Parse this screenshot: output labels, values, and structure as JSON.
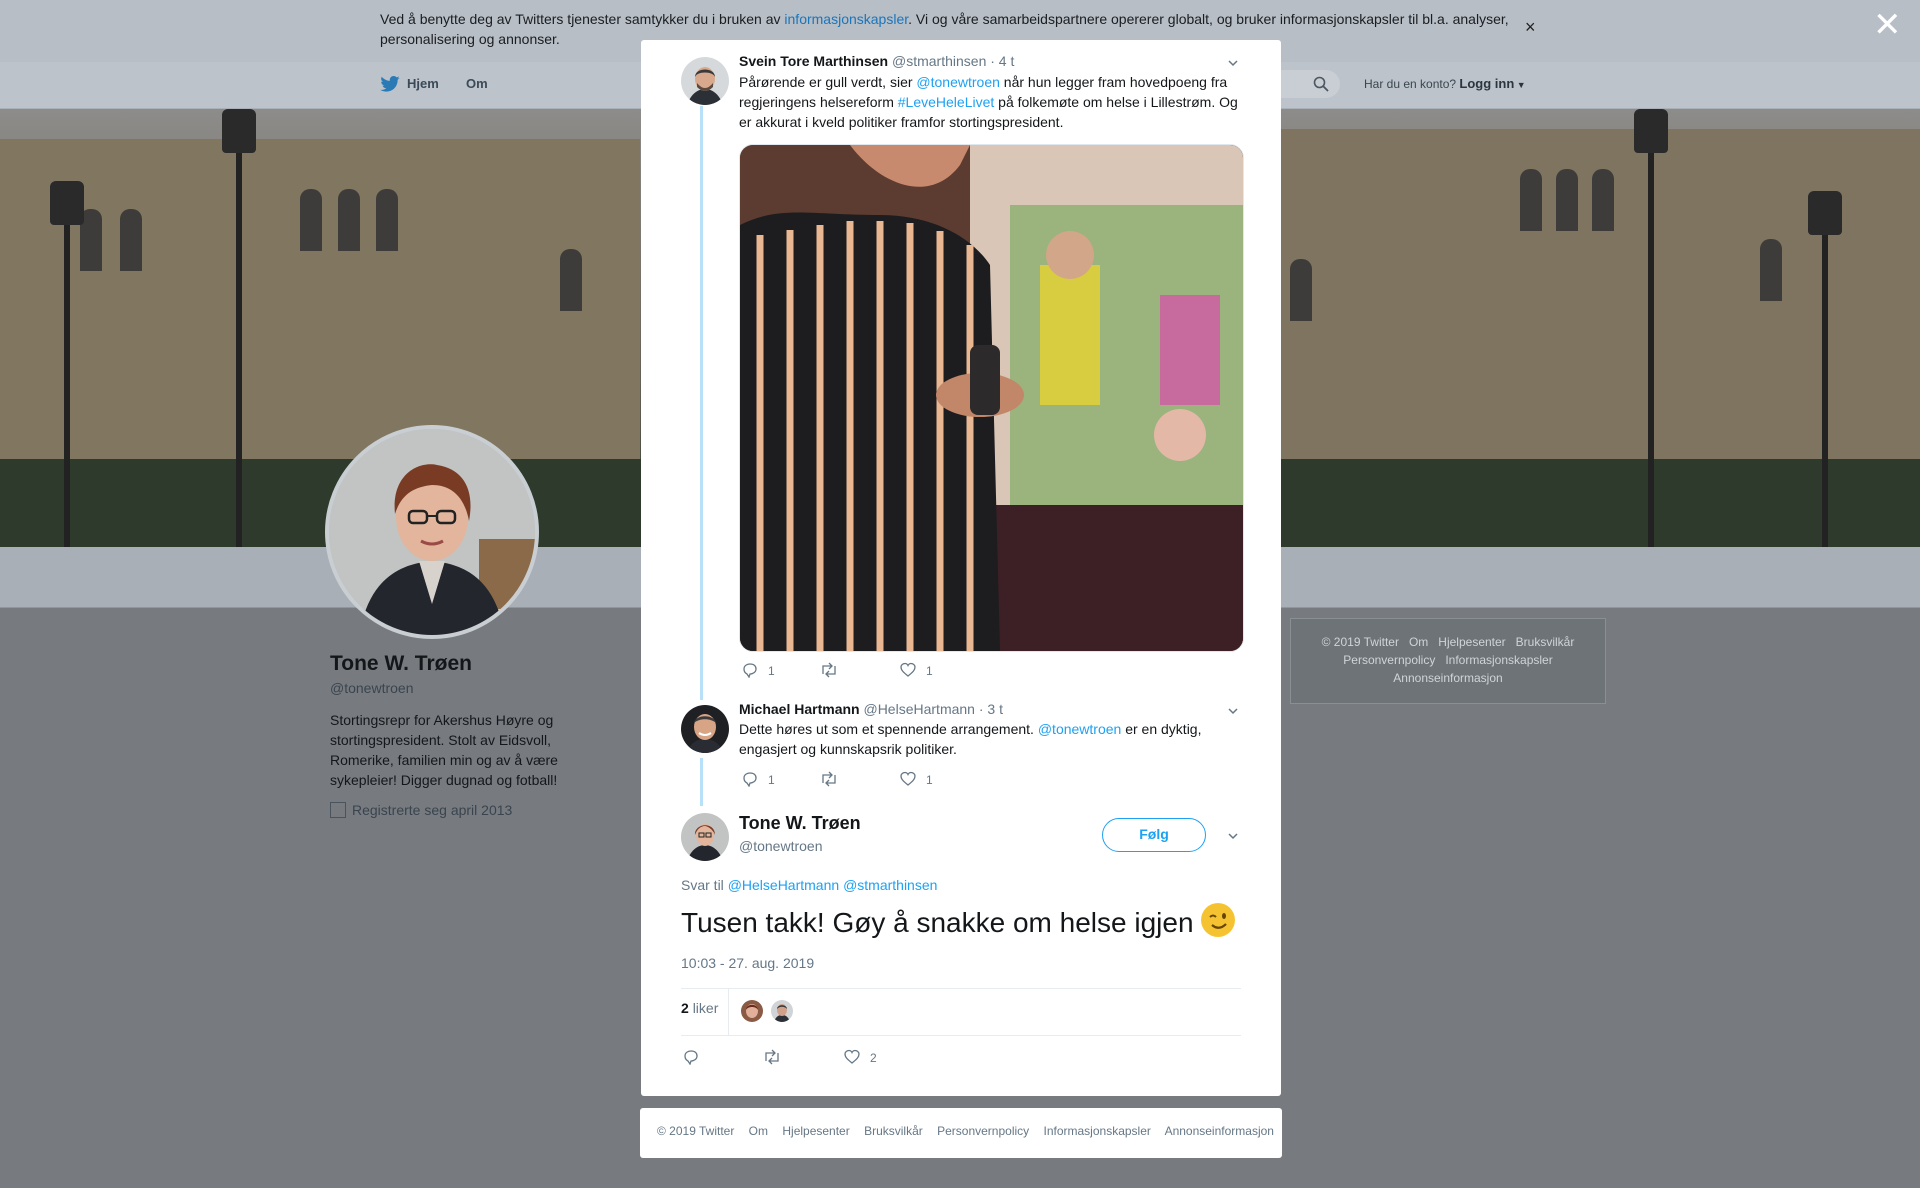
{
  "cookie_banner": {
    "text_before": "Ved å benytte deg av Twitters tjenester samtykker du i bruken av ",
    "link": "informasjonskapsler",
    "text_after": ". Vi og våre samarbeidspartnere opererer globalt, og bruker informasjonskapsler til bl.a. analyser, personalisering og annonser.",
    "close": "×"
  },
  "overlay_close": "✕",
  "nav": {
    "home": "Hjem",
    "about": "Om",
    "account_question": "Har du en konto?",
    "login": "Logg inn"
  },
  "profile": {
    "name": "Tone W. Trøen",
    "handle": "@tonewtroen",
    "bio": "Stortingsrepr for Akershus Høyre og stortingspresident. Stolt av Eidsvoll, Romerike, familien min og av å være sykepleier! Digger dugnad og fotball!",
    "joined": "Registrerte seg april 2013"
  },
  "side_footer": {
    "row1": [
      "© 2019 Twitter",
      "Om",
      "Hjelpesenter",
      "Bruksvilkår"
    ],
    "row2": [
      "Personvernpolicy",
      "Informasjonskapsler"
    ],
    "row3": [
      "Annonseinformasjon"
    ]
  },
  "tweets": [
    {
      "name": "Svein Tore Marthinsen",
      "handle": "@stmarthinsen",
      "time": "· 4 t",
      "text_1": "Pårørende er gull verdt, sier ",
      "mention": "@tonewtroen",
      "text_2": " når hun legger fram hovedpoeng fra regjeringens helsereform  ",
      "hashtag": "#LeveHeleLivet",
      "text_3": " på folkemøte om helse i Lillestrøm. Og er akkurat i kveld politiker framfor stortingspresident.",
      "replies": "1",
      "retweets": "",
      "likes": "1"
    },
    {
      "name": "Michael Hartmann",
      "handle": "@HelseHartmann",
      "time": "· 3 t",
      "text_1": "Dette høres ut som et spennende arrangement. ",
      "mention": "@tonewtroen",
      "text_2": " er en dyktig, engasjert og kunnskapsrik politiker.",
      "replies": "1",
      "retweets": "",
      "likes": "1"
    }
  ],
  "main_tweet": {
    "name": "Tone W. Trøen",
    "handle": "@tonewtroen",
    "follow": "Følg",
    "reply_to_label": "Svar til",
    "reply_to_1": "@HelseHartmann",
    "reply_to_2": "@stmarthinsen",
    "text": "Tusen takk! Gøy å snakke om helse igjen",
    "timestamp": "10:03 - 27. aug. 2019",
    "likes_count": "2",
    "likes_label": "liker",
    "action_likes": "2"
  },
  "modal_footer": [
    "© 2019 Twitter",
    "Om",
    "Hjelpesenter",
    "Bruksvilkår",
    "Personvernpolicy",
    "Informasjonskapsler",
    "Annonseinformasjon"
  ]
}
